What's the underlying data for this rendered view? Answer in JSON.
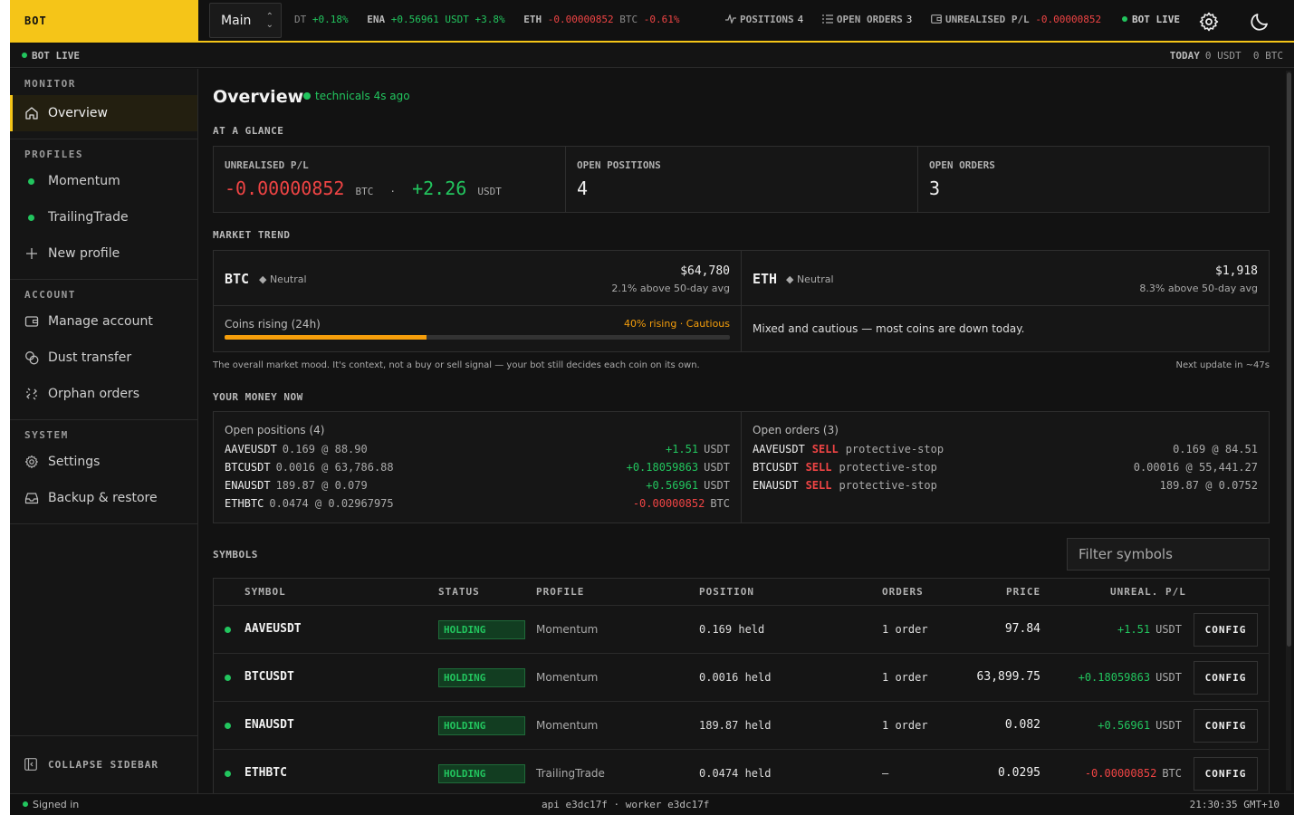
{
  "colors": {
    "accent": "#f5c518",
    "positive": "#22c55e",
    "negative": "#ef4444",
    "warning": "#f59e0b",
    "background": "#121212"
  },
  "topbar": {
    "brand": "BOT",
    "account": "Main",
    "ticker": [
      {
        "symbol": "DT",
        "value": "",
        "change": "+0.18%"
      },
      {
        "symbol": "ENA",
        "value": "+0.56961 USDT",
        "change": "+3.8%"
      },
      {
        "symbol": "ETH",
        "value": "-0.00000852",
        "unit": "BTC",
        "change": "-0.61%"
      }
    ],
    "stats": {
      "positions_label": "POSITIONS",
      "positions_value": "4",
      "orders_label": "OPEN ORDERS",
      "orders_value": "3",
      "unrealised_label": "UNREALISED P/L",
      "unrealised_value": "-0.00000852"
    },
    "live": "BOT LIVE"
  },
  "subbar": {
    "status": "BOT LIVE",
    "today_label": "TODAY",
    "today_value": "0 USDT  0 BTC"
  },
  "sidebar": {
    "monitor_title": "MONITOR",
    "overview": "Overview",
    "profiles_title": "PROFILES",
    "profiles": [
      "Momentum",
      "TrailingTrade"
    ],
    "new_profile": "New profile",
    "account_title": "ACCOUNT",
    "account_items": [
      "Manage account",
      "Dust transfer",
      "Orphan orders"
    ],
    "system_title": "SYSTEM",
    "system_items": [
      "Settings",
      "Backup & restore"
    ],
    "collapse": "COLLAPSE SIDEBAR"
  },
  "main": {
    "title": "Overview",
    "technicals": "technicals 4s ago",
    "glance_title": "AT A GLANCE",
    "kpis": {
      "unrealised_label": "UNREALISED P/L",
      "unrealised_btc": "-0.00000852",
      "btc_unit": "BTC",
      "sep": "·",
      "unrealised_usdt": "+2.26",
      "usdt_unit": "USDT",
      "positions_label": "OPEN POSITIONS",
      "positions_value": "4",
      "orders_label": "OPEN ORDERS",
      "orders_value": "3"
    },
    "trend_title": "MARKET TREND",
    "trend": {
      "btc": {
        "symbol": "BTC",
        "tag": "◆ Neutral",
        "price": "$64,780",
        "sub": "2.1% above 50-day avg"
      },
      "eth": {
        "symbol": "ETH",
        "tag": "◆ Neutral",
        "price": "$1,918",
        "sub": "8.3% above 50-day avg"
      },
      "coins_label": "Coins rising (24h)",
      "coins_status": "40% rising · Cautious",
      "coins_rising_fraction": 0.4,
      "mood": "Mixed and cautious — most coins are down today."
    },
    "trend_note": "The overall market mood. It's context, not a buy or sell signal — your bot still decides each coin on its own.",
    "next_update": "Next update in ~47s",
    "money_title": "YOUR MONEY NOW",
    "positions_header": "Open positions (4)",
    "positions": [
      {
        "symbol": "AAVEUSDT",
        "detail": "0.169 @ 88.90",
        "pl": "+1.51",
        "unit": "USDT",
        "sign": "pos"
      },
      {
        "symbol": "BTCUSDT",
        "detail": "0.0016 @ 63,786.88",
        "pl": "+0.18059863",
        "unit": "USDT",
        "sign": "pos"
      },
      {
        "symbol": "ENAUSDT",
        "detail": "189.87 @ 0.079",
        "pl": "+0.56961",
        "unit": "USDT",
        "sign": "pos"
      },
      {
        "symbol": "ETHBTC",
        "detail": "0.0474 @ 0.02967975",
        "pl": "-0.00000852",
        "unit": "BTC",
        "sign": "neg"
      }
    ],
    "orders_header": "Open orders (3)",
    "orders": [
      {
        "symbol": "AAVEUSDT",
        "side": "SELL",
        "type": "protective-stop",
        "detail": "0.169 @ 84.51"
      },
      {
        "symbol": "BTCUSDT",
        "side": "SELL",
        "type": "protective-stop",
        "detail": "0.00016 @ 55,441.27"
      },
      {
        "symbol": "ENAUSDT",
        "side": "SELL",
        "type": "protective-stop",
        "detail": "189.87 @ 0.0752"
      }
    ],
    "symbols_title": "SYMBOLS",
    "filter_placeholder": "Filter symbols",
    "columns": [
      "SYMBOL",
      "STATUS",
      "PROFILE",
      "POSITION",
      "ORDERS",
      "PRICE",
      "UNREAL. P/L"
    ],
    "rows": [
      {
        "symbol": "AAVEUSDT",
        "status": "HOLDING",
        "profile": "Momentum",
        "position": "0.169 held",
        "orders": "1 order",
        "price": "97.84",
        "pl": "+1.51",
        "unit": "USDT",
        "sign": "pos",
        "action": "CONFIG"
      },
      {
        "symbol": "BTCUSDT",
        "status": "HOLDING",
        "profile": "Momentum",
        "position": "0.0016 held",
        "orders": "1 order",
        "price": "63,899.75",
        "pl": "+0.18059863",
        "unit": "USDT",
        "sign": "pos",
        "action": "CONFIG"
      },
      {
        "symbol": "ENAUSDT",
        "status": "HOLDING",
        "profile": "Momentum",
        "position": "189.87 held",
        "orders": "1 order",
        "price": "0.082",
        "pl": "+0.56961",
        "unit": "USDT",
        "sign": "pos",
        "action": "CONFIG"
      },
      {
        "symbol": "ETHBTC",
        "status": "HOLDING",
        "profile": "TrailingTrade",
        "position": "0.0474 held",
        "orders": "—",
        "price": "0.0295",
        "pl": "-0.00000852",
        "unit": "BTC",
        "sign": "neg",
        "action": "CONFIG"
      }
    ]
  },
  "footer": {
    "signed_in": "Signed in",
    "build": "api e3dc17f · worker e3dc17f",
    "clock": "21:30:35 GMT+10"
  }
}
